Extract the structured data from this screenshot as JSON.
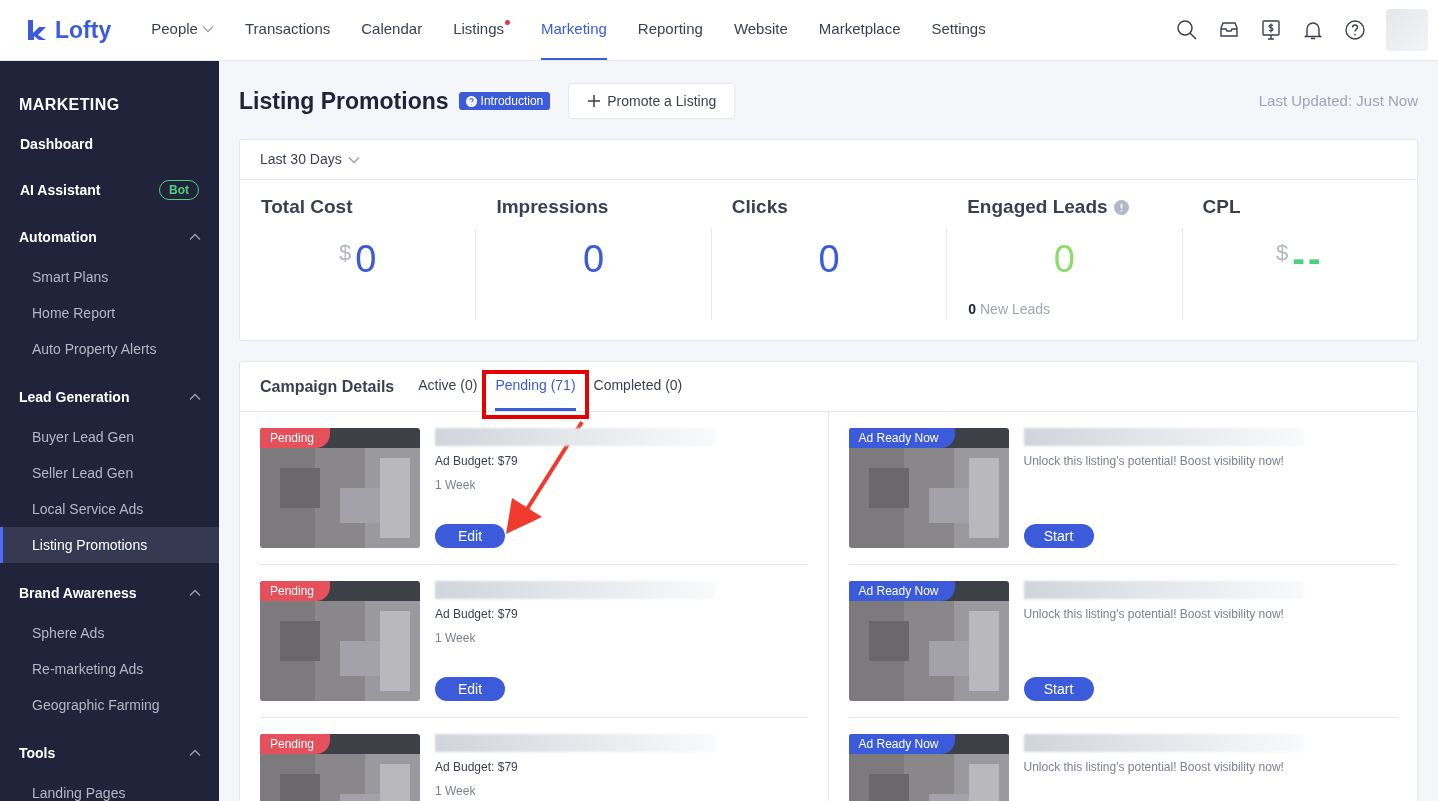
{
  "nav": {
    "logo": "Lofty",
    "items": [
      {
        "label": "People",
        "dropdown": true,
        "dot": false,
        "selected": false
      },
      {
        "label": "Transactions",
        "dropdown": false,
        "dot": false,
        "selected": false
      },
      {
        "label": "Calendar",
        "dropdown": false,
        "dot": false,
        "selected": false
      },
      {
        "label": "Listings",
        "dropdown": false,
        "dot": true,
        "selected": false
      },
      {
        "label": "Marketing",
        "dropdown": false,
        "dot": false,
        "selected": true
      },
      {
        "label": "Reporting",
        "dropdown": false,
        "dot": false,
        "selected": false
      },
      {
        "label": "Website",
        "dropdown": false,
        "dot": false,
        "selected": false
      },
      {
        "label": "Marketplace",
        "dropdown": false,
        "dot": false,
        "selected": false
      },
      {
        "label": "Settings",
        "dropdown": false,
        "dot": false,
        "selected": false
      }
    ]
  },
  "sidebar": {
    "title": "MARKETING",
    "sections": [
      {
        "kind": "link",
        "label": "Dashboard",
        "selected": false
      },
      {
        "kind": "link",
        "label": "AI Assistant",
        "badge": "Bot",
        "selected": false
      },
      {
        "kind": "group",
        "label": "Automation",
        "expanded": true,
        "children": [
          {
            "label": "Smart Plans",
            "selected": false
          },
          {
            "label": "Home Report",
            "selected": false
          },
          {
            "label": "Auto Property Alerts",
            "selected": false
          }
        ]
      },
      {
        "kind": "group",
        "label": "Lead Generation",
        "expanded": true,
        "children": [
          {
            "label": "Buyer Lead Gen",
            "selected": false
          },
          {
            "label": "Seller Lead Gen",
            "selected": false
          },
          {
            "label": "Local Service Ads",
            "selected": false
          },
          {
            "label": "Listing Promotions",
            "selected": true
          }
        ]
      },
      {
        "kind": "group",
        "label": "Brand Awareness",
        "expanded": true,
        "children": [
          {
            "label": "Sphere Ads",
            "selected": false
          },
          {
            "label": "Re-marketing Ads",
            "selected": false
          },
          {
            "label": "Geographic Farming",
            "selected": false
          }
        ]
      },
      {
        "kind": "group",
        "label": "Tools",
        "expanded": true,
        "children": [
          {
            "label": "Landing Pages",
            "selected": false
          }
        ]
      }
    ]
  },
  "header": {
    "title": "Listing Promotions",
    "intro_badge": "Introduction",
    "promote_button": "Promote a Listing",
    "last_updated": "Last Updated: Just Now"
  },
  "stats": {
    "period": "Last 30 Days",
    "metrics": [
      {
        "label": "Total Cost",
        "prefix": "$",
        "value": "0",
        "color": "#3b5bdb"
      },
      {
        "label": "Impressions",
        "value": "0",
        "color": "#3b5bdb"
      },
      {
        "label": "Clicks",
        "value": "0",
        "color": "#3b5bdb"
      },
      {
        "label": "Engaged Leads",
        "value": "0",
        "color": "#8fdb6e",
        "info": true,
        "sub_count": "0",
        "sub_label": "New Leads"
      },
      {
        "label": "CPL",
        "prefix": "$",
        "value": "--",
        "color": "#4cd07d"
      }
    ]
  },
  "campaigns": {
    "title": "Campaign Details",
    "arrow": true,
    "tabs": [
      {
        "label": "Active (0)",
        "selected": false,
        "highlighted": false
      },
      {
        "label": "Pending (71)",
        "selected": true,
        "highlighted": true
      },
      {
        "label": "Completed (0)",
        "selected": false,
        "highlighted": false
      }
    ],
    "columns": [
      [
        {
          "status": "Pending",
          "color": "#e5505a",
          "lines": [
            "Ad Budget: $79",
            "1 Week"
          ],
          "button": "Edit"
        },
        {
          "status": "Pending",
          "color": "#e5505a",
          "lines": [
            "Ad Budget: $79",
            "1 Week"
          ],
          "button": "Edit"
        },
        {
          "status": "Pending",
          "color": "#e5505a",
          "lines": [
            "Ad Budget: $79",
            "1 Week"
          ]
        }
      ],
      [
        {
          "status": "Ad Ready Now",
          "color": "#3b5bdb",
          "lines": [
            "Unlock this listing's potential! Boost visibility now!"
          ],
          "button": "Start"
        },
        {
          "status": "Ad Ready Now",
          "color": "#3b5bdb",
          "lines": [
            "Unlock this listing's potential! Boost visibility now!"
          ],
          "button": "Start"
        },
        {
          "status": "Ad Ready Now",
          "color": "#3b5bdb",
          "lines": [
            "Unlock this listing's potential! Boost visibility now!"
          ]
        }
      ]
    ]
  }
}
